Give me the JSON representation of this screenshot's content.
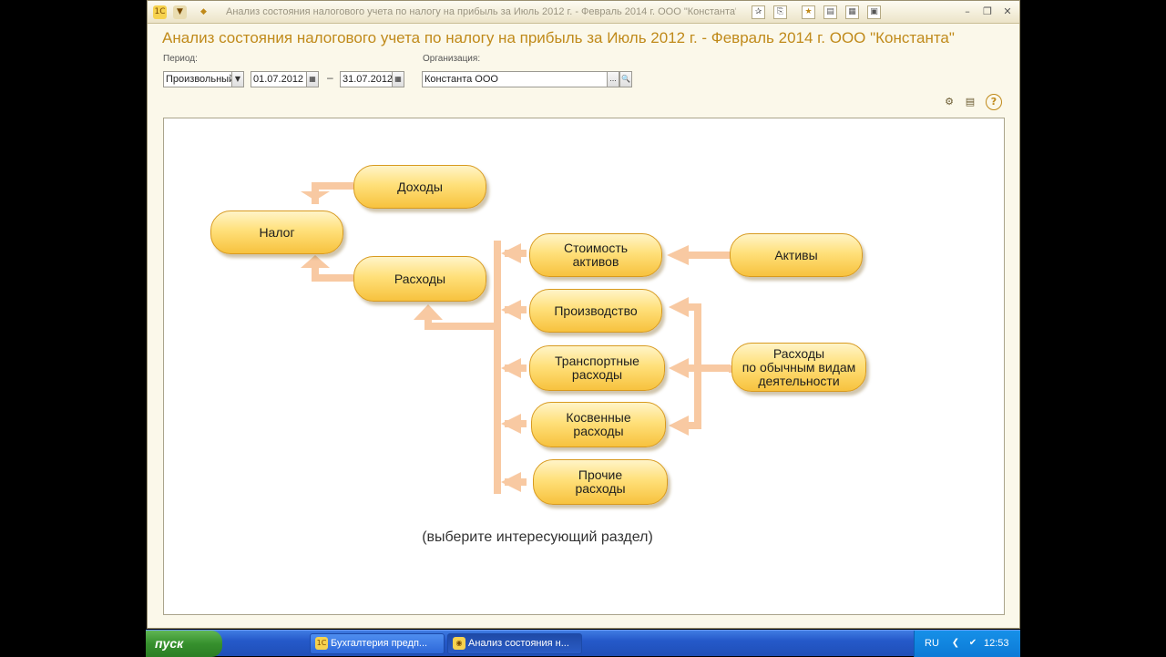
{
  "window": {
    "title": "Анализ состояния налогового учета по налогу на прибыль за Июль 2012 г. - Февраль 2014 г. ООО \"Константа\"",
    "document_title": "Анализ состояния налогового учета по налогу на прибыль за Июль 2012 г. - Февраль 2014 г. ООО \"Константа\""
  },
  "filters": {
    "period_label": "Период:",
    "period_mode": "Произвольный",
    "date_from": "01.07.2012",
    "date_separator": "–",
    "date_to": "31.07.2012",
    "organization_label": "Организация:",
    "organization": "Константа ООО",
    "select_button": "...",
    "search_glyph": "🔍"
  },
  "diagram": {
    "nodes": {
      "nalog": "Налог",
      "dohody": "Доходы",
      "rashody": "Расходы",
      "stoimost_1": "Стоимость",
      "stoimost_2": "активов",
      "aktivy": "Активы",
      "proizvodstvo": "Производство",
      "transport_1": "Транспортные",
      "transport_2": "расходы",
      "obychnye_1": "Расходы",
      "obychnye_2": "по обычным видам",
      "obychnye_3": "деятельности",
      "kosvennye_1": "Косвенные",
      "kosvennye_2": "расходы",
      "prochie_1": "Прочие",
      "prochie_2": "расходы"
    },
    "hint": "(выберите интересующий раздел)",
    "colors": {
      "node_fill": "#ffe07a",
      "node_border": "#d89a1f",
      "arrow": "#f8c9a2",
      "title": "#c08a1a"
    }
  },
  "taskbar": {
    "start_label": "пуск",
    "tasks": [
      {
        "label": "Бухгалтерия предп...",
        "icon": "1c-app-icon"
      },
      {
        "label": "Анализ состояния н...",
        "icon": "report-icon"
      }
    ],
    "language": "RU",
    "clock": "12:53"
  }
}
